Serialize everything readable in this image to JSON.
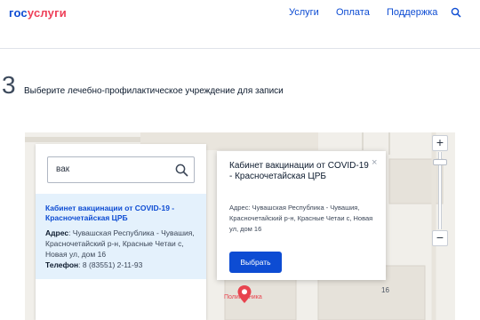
{
  "header": {
    "logo_part1": "гос",
    "logo_part2": "услуги",
    "nav": [
      "Услуги",
      "Оплата",
      "Поддержка"
    ]
  },
  "step": {
    "number": "3",
    "title": "Выберите лечебно-профилактическое учреждение для записи"
  },
  "search": {
    "value": "вак"
  },
  "result": {
    "title": "Кабинет вакцинации от COVID-19 - Красночетайская ЦРБ",
    "address_label": "Адрес",
    "address": ": Чувашская Республика - Чувашия, Красночетайский р-н, Красные Четаи с, Новая ул, дом 16",
    "phone_label": "Телефон",
    "phone": ": 8 (83551) 2-11-93"
  },
  "popup": {
    "title": "Кабинет вакцинации от COVID-19 - Красночетайская ЦРБ",
    "address": "Адрес: Чувашская Республика - Чувашия, Красночетайский р-н, Красные Четаи с, Новая ул, дом 16",
    "button": "Выбрать",
    "close": "×"
  },
  "map": {
    "pin_label": "Поликлиника",
    "building_number": "16",
    "zoom_in": "+",
    "zoom_out": "−"
  },
  "colors": {
    "brand_blue": "#0d4cd3",
    "brand_red": "#ee3f58",
    "result_highlight": "#e4f1fc",
    "pin": "#e8434e"
  }
}
